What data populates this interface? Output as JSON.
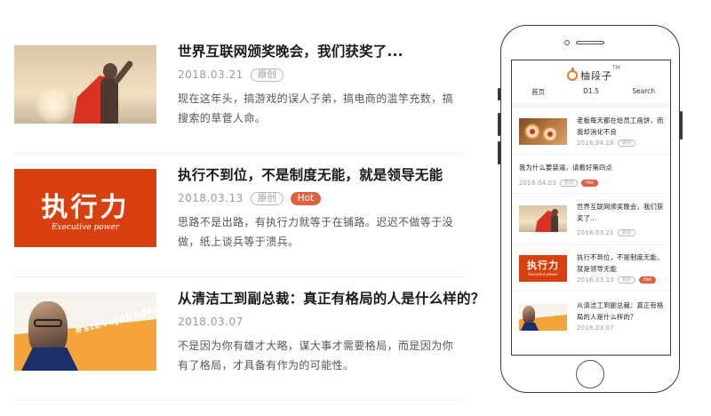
{
  "articles": [
    {
      "title": "世界互联网颁奖晚会，我们获奖了...",
      "date": "2018.03.21",
      "badges": [
        "原创"
      ],
      "summary": "现在这年头，搞游戏的误人子弟，搞电商的滥竽充数，搞搜索的草菅人命。"
    },
    {
      "title": "执行不到位，不是制度无能，就是领导无能",
      "date": "2018.03.13",
      "badges": [
        "原创",
        "Hot"
      ],
      "summary": "思路不是出路，有执行力就等于在铺路。迟迟不做等于没做，纸上谈兵等于溃兵。",
      "thumb_big": "执行力",
      "thumb_small": "Executive power"
    },
    {
      "title": "从清洁工到副总裁：真正有格局的人是什么样的？",
      "date": "2018.03.07",
      "badges": [],
      "summary": "不是因为你有雄才大略，谋大事才需要格局，而是因为你有了格局，才具备有作为的可能性。",
      "thumb_tag": "#stevejobsday"
    }
  ],
  "mobile": {
    "logo": "柚段子",
    "tm": "TM",
    "nav": [
      "首页",
      "D1.5",
      "Search"
    ],
    "items": [
      {
        "title": "老板每天都在给员工画饼，而我却消化不良",
        "date": "2018.04.18",
        "badge": "原创"
      },
      {
        "title": "我为什么要装逼，请看好第四点",
        "date": "2018.04.03",
        "badge": "原创",
        "badge2": "Hot"
      },
      {
        "title": "世界互联网颁奖晚会，我们获奖了...",
        "date": "2018.03.21",
        "badge": "原创"
      },
      {
        "title": "执行不到位，不是制度无能，就是领导无能",
        "date": "2018.03.13",
        "badge": "原创",
        "badge2": "Hot",
        "thumb_big": "执行力",
        "thumb_small": "Executive power"
      },
      {
        "title": "从清洁工到副总裁：真正有格局的人是什么样的？",
        "date": "2018.03.07"
      }
    ]
  },
  "colors": {
    "accent": "#e0613f",
    "thumb_red": "#d8400f",
    "logo_orange": "#e97a2b"
  }
}
